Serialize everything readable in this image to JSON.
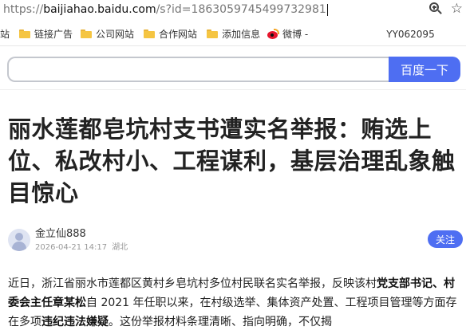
{
  "address_bar": {
    "scheme": "https://",
    "host": "baijiahao.baidu.com",
    "path": "/s?id=1863059745499732981"
  },
  "icons": {
    "zoom": "zoom-in-icon",
    "bookmark": "star-icon",
    "folder": "folder-icon",
    "weibo": "weibo-icon",
    "avatar": "avatar-icon"
  },
  "bookmarks": {
    "partial_first": "站",
    "items": [
      "链接广告",
      "公司网站",
      "合作网站",
      "添加信息"
    ],
    "weibo": "微博 -",
    "user_id": "YY062095"
  },
  "search": {
    "value": "",
    "button_label": "百度一下"
  },
  "article": {
    "title": "丽水莲都皂坑村支书遭实名举报：贿选上位、私改村小、工程谋利，基层治理乱象触目惊心",
    "author": "金立仙888",
    "date": "2026-04-21 14:17",
    "location": "湖北",
    "follow_label": "关注",
    "body": {
      "p1": "近日，浙江省丽水市莲都区黄村乡皂坑村多位村民联名实名举报，反映该村",
      "b1": "党支部书记、村委会主任章某松",
      "p2": "自 2021 年任职以来，在村级选举、集体资产处置、工程项目管理等方面存在多项",
      "b2": "违纪违法嫌疑",
      "p3": "。这份举报材料条理清晰、指向明确，不仅揭"
    }
  },
  "colors": {
    "accent": "#4e6ef2",
    "folder": "#f5c542",
    "weibo": "#e6162d"
  }
}
